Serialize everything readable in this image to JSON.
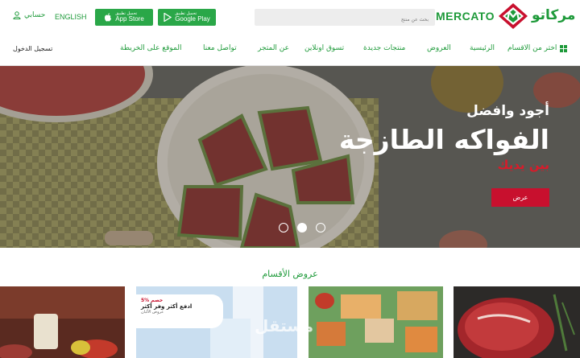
{
  "header": {
    "account_label": "حسابي",
    "language": "ENGLISH",
    "app_store": {
      "small": "تحميل تطبيق",
      "big": "App Store"
    },
    "google_play": {
      "small": "تحميل تطبيق",
      "big": "Google Play"
    },
    "search_placeholder": "بحث عن منتج",
    "logo_en": "MERCATO",
    "logo_ar": "مركاتو"
  },
  "nav": {
    "categories": "اختر من الاقسام",
    "items": [
      "الرئيسية",
      "العروض",
      "منتجات جديدة",
      "تسوق اونلاين",
      "عن المتجر",
      "تواصل معنا",
      "الموقع على الخريطة"
    ],
    "login": "تسجيل الدخول"
  },
  "hero": {
    "line1": "أجود  وافضل",
    "line2": "الفواكه الطازجة",
    "line3": "بين يديك",
    "button": "عرض",
    "slides_total": 3,
    "active_slide": 2
  },
  "section": {
    "title": "عروض الأقسام"
  },
  "promo_card": {
    "line1": "5% خصم",
    "line2": "ادفع أكثر وفر أكثر",
    "line3": "عروض الألبان"
  },
  "watermark": "مستقل",
  "colors": {
    "brand_green": "#1e9a3a",
    "accent_red": "#c8102e"
  }
}
